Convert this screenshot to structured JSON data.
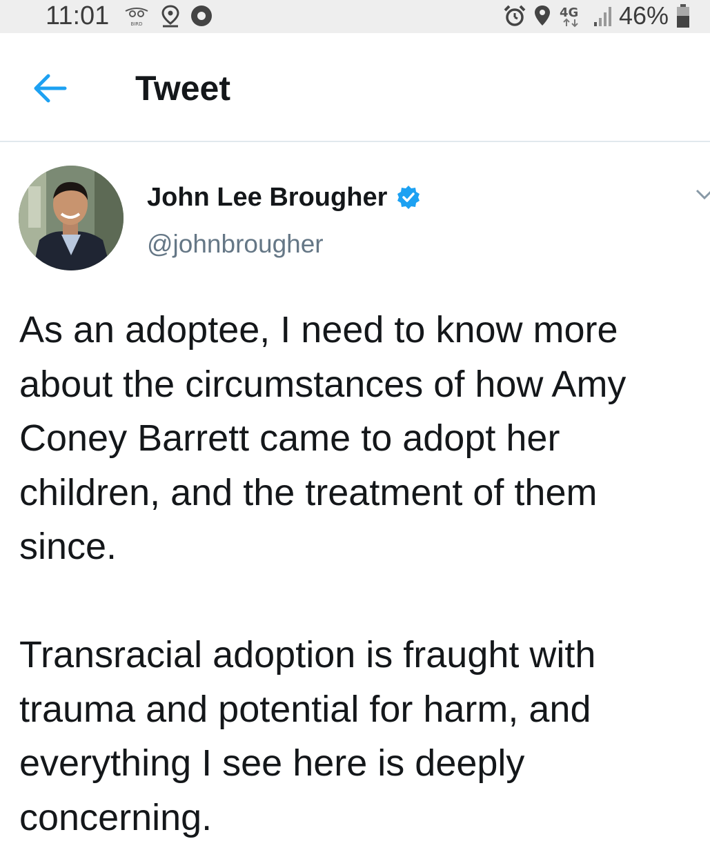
{
  "status_bar": {
    "time": "11:01",
    "left_icons": [
      "bird-icon",
      "location-pin-icon",
      "notification-dot-icon"
    ],
    "right_icons": [
      "alarm-icon",
      "location-icon",
      "4g-icon",
      "signal-icon",
      "battery-icon"
    ],
    "network": "4G",
    "battery": "46%"
  },
  "appbar": {
    "back_icon": "arrow-left-icon",
    "title": "Tweet"
  },
  "tweet": {
    "author_name": "John Lee Brougher",
    "verified": true,
    "handle": "@johnbrougher",
    "paragraphs": [
      "As an adoptee, I need to know more about the circumstances of how Amy Coney Barrett came to adopt her children, and the treatment of them since.",
      "Transracial adoption is fraught with trauma and potential for harm, and everything I see here is deeply concerning."
    ]
  },
  "colors": {
    "accent": "#1da1f2",
    "text": "#14171a",
    "secondary_text": "#657786",
    "status_bar_bg": "#eeeeee",
    "divider": "#e1e8ed"
  }
}
